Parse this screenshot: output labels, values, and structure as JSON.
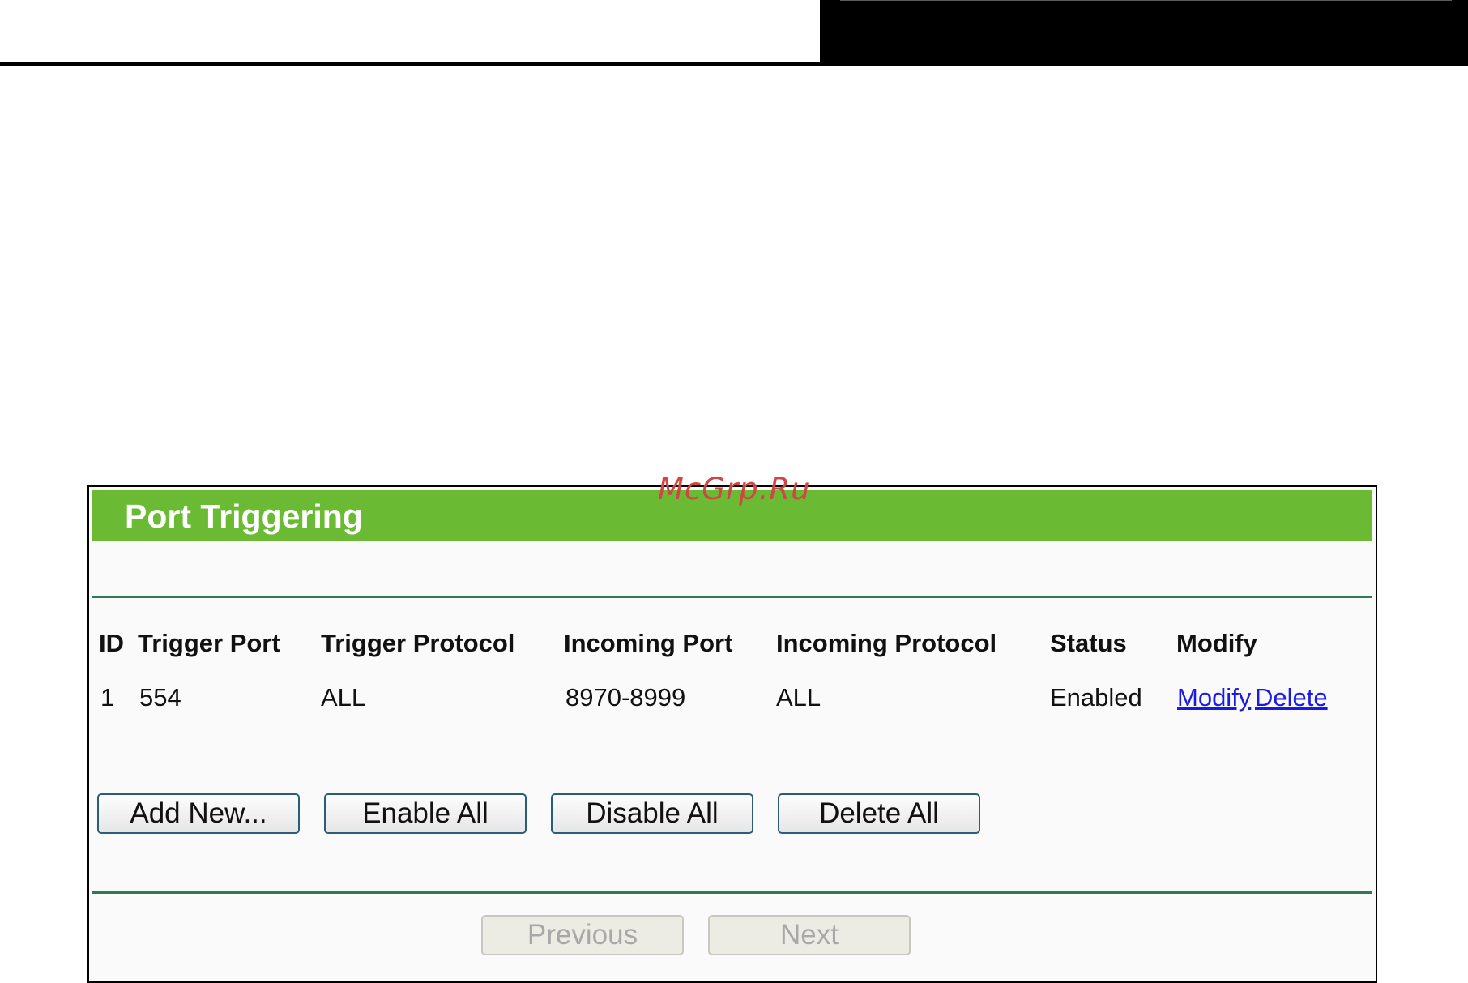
{
  "watermark": "McGrp.Ru",
  "panel": {
    "title": "Port Triggering"
  },
  "table": {
    "headers": [
      "ID",
      "Trigger Port",
      "Trigger Protocol",
      "Incoming Port",
      "Incoming Protocol",
      "Status",
      "Modify"
    ],
    "rows": [
      {
        "id": "1",
        "trigger_port": "554",
        "trigger_protocol": "ALL",
        "incoming_port": "8970-8999",
        "incoming_protocol": "ALL",
        "status": "Enabled",
        "modify_link": "Modify",
        "delete_link": "Delete"
      }
    ]
  },
  "actions": {
    "add_new": "Add New...",
    "enable_all": "Enable All",
    "disable_all": "Disable All",
    "delete_all": "Delete All"
  },
  "pagination": {
    "previous": "Previous",
    "next": "Next"
  },
  "colors": {
    "header_green": "#6aba34",
    "divider_green": "#2f7a55",
    "link_blue": "#1a1ae6",
    "watermark_red": "#d24545"
  }
}
